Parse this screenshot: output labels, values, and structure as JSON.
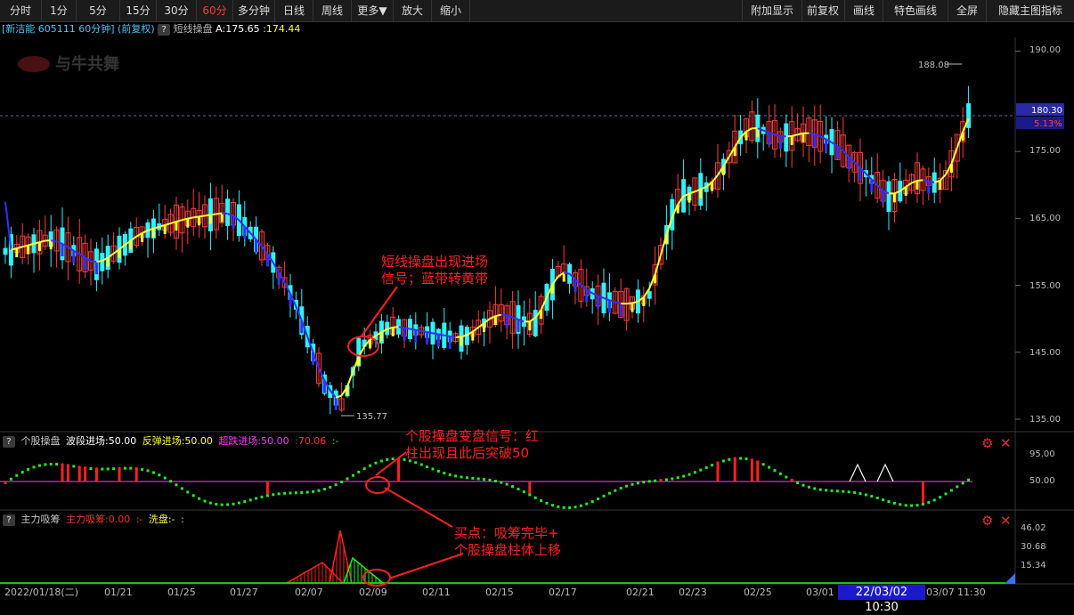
{
  "toolbar": {
    "left": [
      "分时",
      "1分",
      "5分",
      "15分",
      "30分",
      "60分",
      "多分钟",
      "日线",
      "周线",
      "更多▼",
      "放大",
      "缩小"
    ],
    "active": "60分",
    "right": [
      "附加显示",
      "前复权",
      "画线",
      "特色画线",
      "全屏",
      "隐藏主图指标"
    ]
  },
  "info": {
    "stock": "[新洁能 605111 60分钟] (前复权)",
    "indicator": "短线操盘",
    "a_value": "A:175.65",
    "b_value": ":174.44"
  },
  "watermark": "与牛共舞",
  "price_axis": {
    "ticks": [
      "190.00",
      "175.00",
      "165.00",
      "155.00",
      "145.00",
      "135.00"
    ],
    "current": "180.30",
    "change": "5.13%",
    "high_marker": "188.08",
    "low_marker": "135.77"
  },
  "pane2": {
    "name": "个股操盘",
    "p1": "波段进场:50.00",
    "p2": "反弹进场:50.00",
    "p3": "超跌进场:50.00",
    "p4": ":70.06",
    "p5": ":-",
    "ticks": [
      "95.00",
      "50.00"
    ]
  },
  "pane3": {
    "name": "主力吸筹",
    "p1": "主力吸筹:0.00",
    "p2": ":-",
    "p3": "洗盘:-",
    "p4": ":",
    "ticks": [
      "46.02",
      "30.68",
      "15.34"
    ]
  },
  "dates": [
    "2022/01/18(二)",
    "01/21",
    "01/25",
    "01/27",
    "02/07",
    "02/09",
    "02/11",
    "02/15",
    "02/17",
    "02/21",
    "02/23",
    "02/25",
    "03/01",
    "03/07",
    "11:30"
  ],
  "cursor_time": "22/03/02 10:30",
  "annotations": {
    "a1": "短线操盘出现进场",
    "a2": "信号；蓝带转黄带",
    "b1": "个股操盘变盘信号：红",
    "b2": "柱出现且此后突破50",
    "c1": "买点：吸筹完毕+",
    "c2": "个股操盘柱体上移"
  },
  "colors": {
    "up": "#ff3b3b",
    "down": "#2ff2ff",
    "band_up": "#ffff33",
    "band_down": "#3030ff",
    "signal_up": "#ff2020",
    "signal_down": "#22ee22",
    "midline": "#cc33cc"
  }
}
